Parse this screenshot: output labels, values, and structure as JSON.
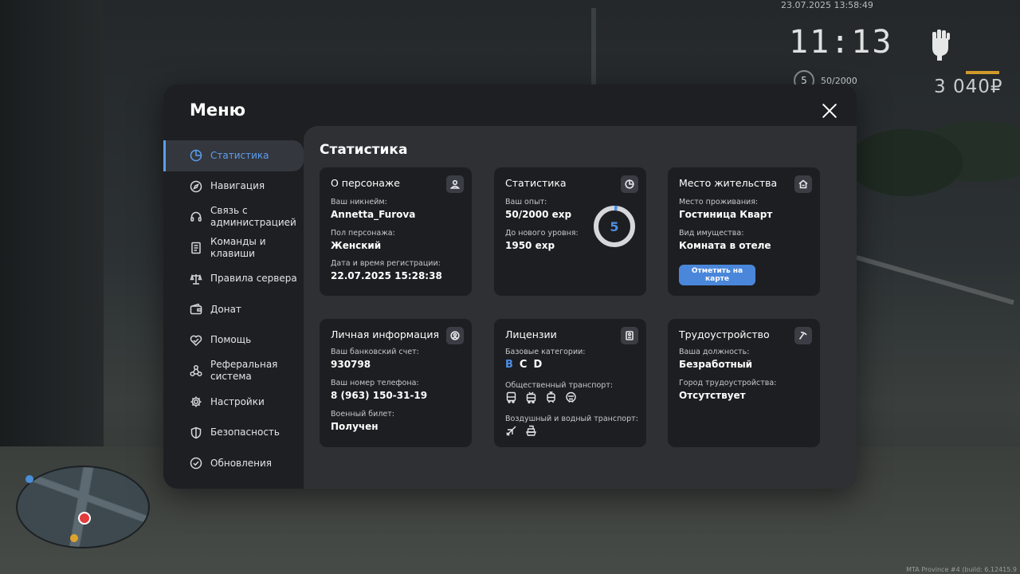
{
  "hud": {
    "datetime": "23.07.2025 13:58:49",
    "clock": "11:13",
    "level": "5",
    "exp": "50/2000",
    "money": "3 040₽",
    "build": "MTA Province #4 (build: 6.12415.9"
  },
  "menu": {
    "title": "Меню",
    "sidebar": [
      {
        "label": "Статистика",
        "icon": "pie-chart-icon",
        "active": true
      },
      {
        "label": "Навигация",
        "icon": "compass-icon"
      },
      {
        "label": "Связь с администрацией",
        "icon": "headset-icon"
      },
      {
        "label": "Команды и клавиши",
        "icon": "document-icon"
      },
      {
        "label": "Правила сервера",
        "icon": "scales-icon"
      },
      {
        "label": "Донат",
        "icon": "wallet-icon"
      },
      {
        "label": "Помощь",
        "icon": "heart-handshake-icon"
      },
      {
        "label": "Реферальная система",
        "icon": "network-icon"
      },
      {
        "label": "Настройки",
        "icon": "gear-icon"
      },
      {
        "label": "Безопасность",
        "icon": "shield-icon"
      },
      {
        "label": "Обновления",
        "icon": "check-circle-icon"
      }
    ]
  },
  "content": {
    "title": "Статистика",
    "character": {
      "title": "О персонаже",
      "icon": "user-icon",
      "nickname_label": "Ваш никнейм:",
      "nickname": "Annetta_Furova",
      "gender_label": "Пол персонажа:",
      "gender": "Женский",
      "reg_label": "Дата и время регистрации:",
      "reg": "22.07.2025 15:28:38"
    },
    "stats": {
      "title": "Статистика",
      "icon": "pie-chart-icon",
      "exp_label": "Ваш опыт:",
      "exp": "50/2000 exp",
      "next_label": "До нового уровня:",
      "next": "1950 exp",
      "level": "5",
      "progress": 0.025
    },
    "residence": {
      "title": "Место жительства",
      "icon": "house-icon",
      "place_label": "Место проживания:",
      "place": "Гостиница Кварт",
      "property_label": "Вид имущества:",
      "property": "Комната в отеле",
      "map_button": "Отметить на карте"
    },
    "personal": {
      "title": "Личная информация",
      "icon": "user-circle-icon",
      "bank_label": "Ваш банковский счет:",
      "bank": "930798",
      "phone_label": "Ваш номер телефона:",
      "phone": "8 (963) 150-31-19",
      "military_label": "Военный билет:",
      "military": "Получен"
    },
    "licenses": {
      "title": "Лицензии",
      "icon": "id-card-icon",
      "base_label": "Базовые категории:",
      "categories": [
        {
          "label": "B",
          "owned": true
        },
        {
          "label": "C",
          "owned": false
        },
        {
          "label": "D",
          "owned": false
        }
      ],
      "public_label": "Общественный транспорт:",
      "public_icons": [
        "bus-icon",
        "trolleybus-icon",
        "tram-icon",
        "metro-icon"
      ],
      "air_label": "Воздушный и водный транспорт:",
      "air_icons": [
        "plane-icon",
        "ship-icon"
      ]
    },
    "employment": {
      "title": "Трудоустройство",
      "icon": "pickaxe-icon",
      "position_label": "Ваша должность:",
      "position": "Безработный",
      "city_label": "Город трудоустройства:",
      "city": "Отсутствует"
    }
  },
  "colors": {
    "accent": "#4d8fe6",
    "window_bg": "#1e1f22",
    "panel_bg": "#2f3034",
    "card_bg": "#1d1e21"
  }
}
